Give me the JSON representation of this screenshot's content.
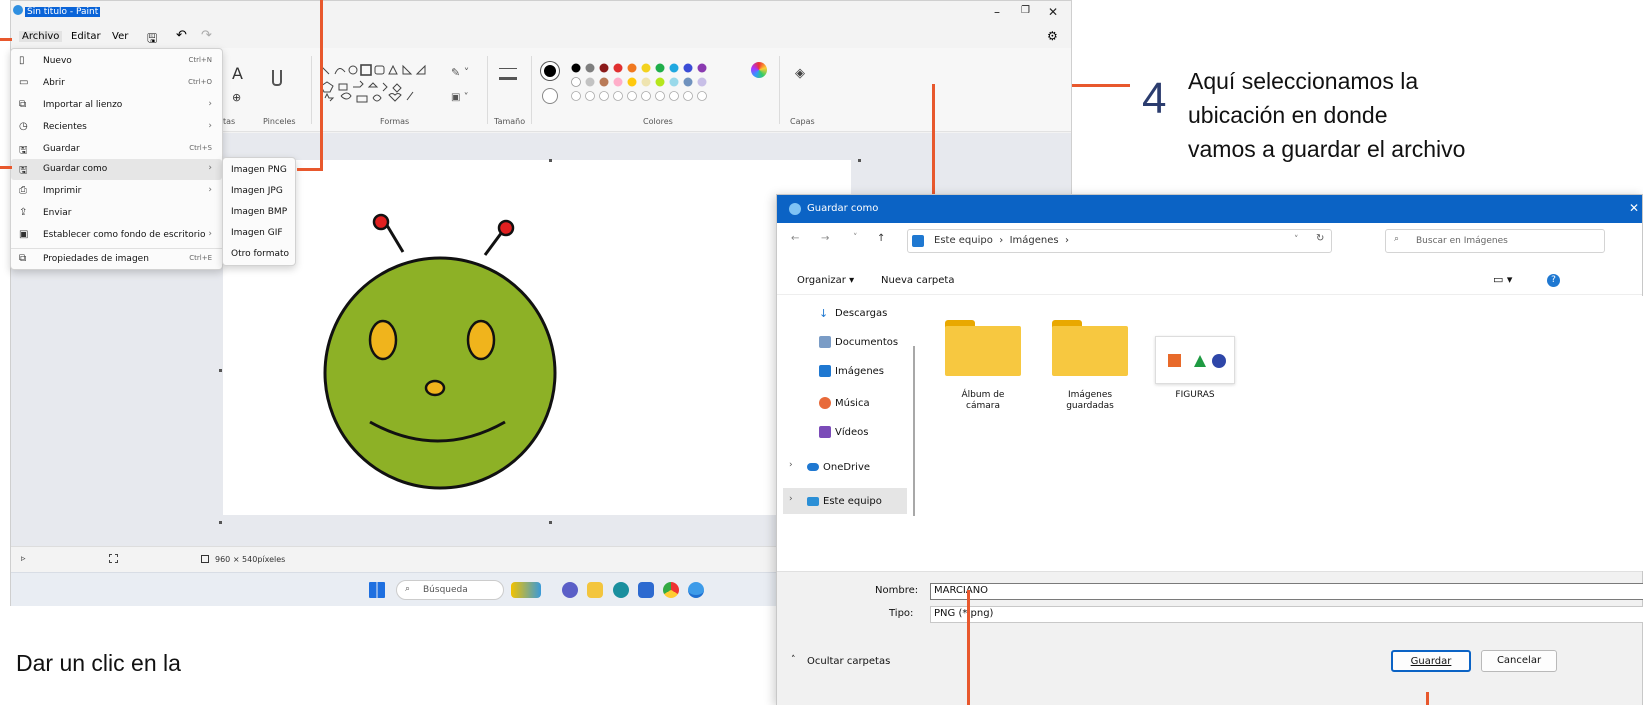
{
  "paint": {
    "title": "Sin título - Paint",
    "menu": [
      "Archivo",
      "Editar",
      "Ver"
    ],
    "ribbon_labels": [
      "tas",
      "Pinceles",
      "Formas",
      "Tamaño",
      "Colores",
      "Capas"
    ],
    "status_size": "960 × 540píxeles",
    "taskbar_search": "Búsqueda"
  },
  "file_menu": [
    {
      "label": "Nuevo",
      "shortcut": "Ctrl+N",
      "icon": "new-file-icon"
    },
    {
      "label": "Abrir",
      "shortcut": "Ctrl+O",
      "icon": "open-folder-icon"
    },
    {
      "label": "Importar al lienzo",
      "arrow": "›",
      "icon": "import-icon"
    },
    {
      "label": "Recientes",
      "arrow": "›",
      "icon": "clock-icon"
    },
    {
      "label": "Guardar",
      "shortcut": "Ctrl+S",
      "icon": "save-icon"
    },
    {
      "label": "Guardar como",
      "arrow": "›",
      "icon": "save-as-icon"
    },
    {
      "label": "Imprimir",
      "arrow": "›",
      "icon": "print-icon"
    },
    {
      "label": "Enviar",
      "icon": "share-icon"
    },
    {
      "label": "Establecer como fondo de escritorio",
      "arrow": "›",
      "icon": "wallpaper-icon"
    },
    {
      "label": "Propiedades de imagen",
      "shortcut": "Ctrl+E",
      "icon": "properties-icon"
    }
  ],
  "save_as_submenu": [
    "Imagen PNG",
    "Imagen JPG",
    "Imagen BMP",
    "Imagen GIF",
    "Otro formato"
  ],
  "dialog": {
    "title": "Guardar como",
    "path": "Este equipo  ›  Imágenes  ›",
    "search_placeholder": "Buscar en Imágenes",
    "organize": "Organizar ▾",
    "new_folder": "Nueva carpeta",
    "sidebar": [
      "Descargas",
      "Documentos",
      "Imágenes",
      "Música",
      "Vídeos",
      "OneDrive",
      "Este equipo"
    ],
    "items": [
      {
        "label": "Álbum de\ncámara"
      },
      {
        "label": "Imágenes\nguardadas"
      },
      {
        "label": "FIGURAS"
      }
    ],
    "name_label": "Nombre:",
    "name_value": "MARCIANO",
    "type_label": "Tipo:",
    "type_value": "PNG (*.png)",
    "hide_folders": "Ocultar carpetas",
    "save_button": "Guardar",
    "cancel_button": "Cancelar"
  },
  "annotations": {
    "step4_number": "4",
    "step4_line1": "Aquí seleccionamos la",
    "step4_line2": "ubicación en donde",
    "step4_line3": "vamos a guardar el archivo",
    "bottom_text": "Dar un clic en la"
  },
  "colors": {
    "accent": "#e8582d",
    "dialog_title": "#0b63c5",
    "face": "#8db126"
  }
}
